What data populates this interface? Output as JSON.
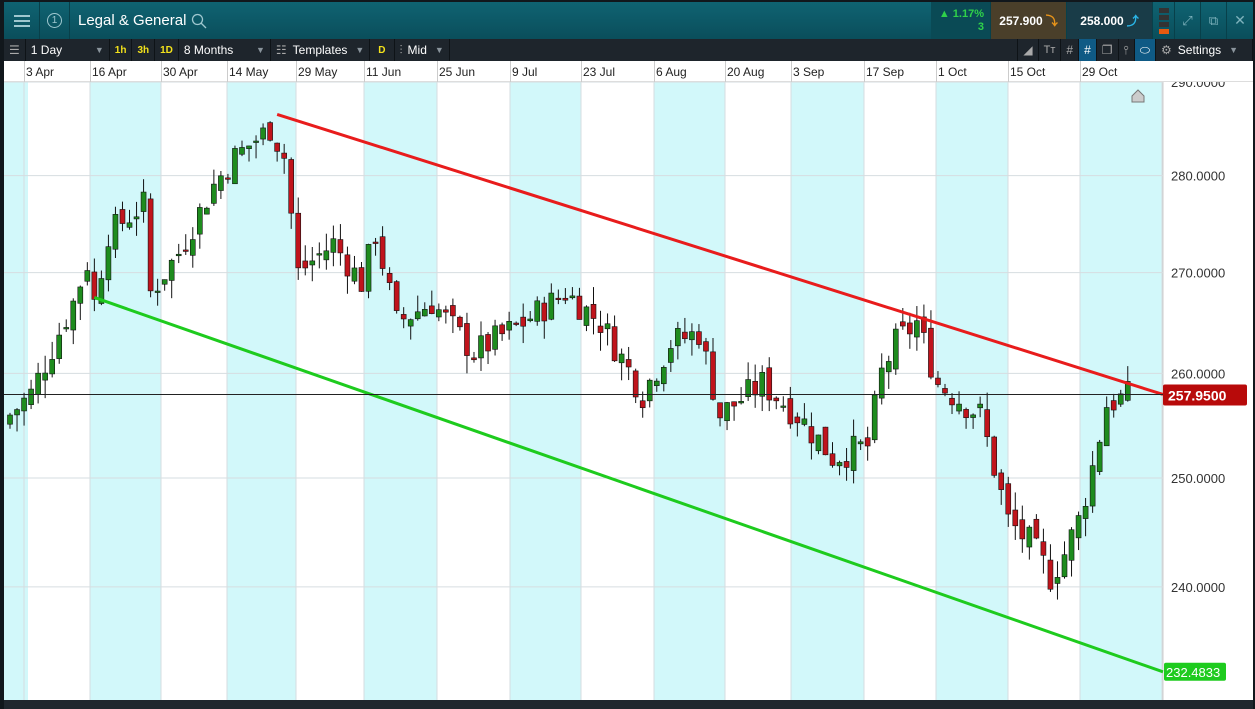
{
  "header": {
    "title": "Legal & General",
    "window_number": "1",
    "change_pct": "▲ 1.17%",
    "change_sub": "3",
    "sell_price": "257.900",
    "buy_price": "258.000"
  },
  "toolbar": {
    "interval": "1 Day",
    "quick": [
      "1h",
      "3h",
      "1D"
    ],
    "range": "8 Months",
    "templates": "Templates",
    "d_button": "D",
    "price_type": "Mid",
    "settings": "Settings"
  },
  "date_axis": [
    "3 Apr",
    "16 Apr",
    "30 Apr",
    "14 May",
    "29 May",
    "11 Jun",
    "25 Jun",
    "9 Jul",
    "23 Jul",
    "6 Aug",
    "20 Aug",
    "3 Sep",
    "17 Sep",
    "1 Oct",
    "15 Oct",
    "29 Oct"
  ],
  "price_axis": [
    "290.0000",
    "280.0000",
    "270.0000",
    "260.0000",
    "250.0000",
    "240.0000"
  ],
  "current_price_label": "257.9500",
  "support_label": "232.4833",
  "colors": {
    "up": "#1e8c1e",
    "down": "#c0141c",
    "resistance": "#e81c1c",
    "support": "#1ecb1e",
    "shade": "#d2f8fa"
  },
  "chart_data": {
    "type": "candlestick",
    "instrument": "Legal & General",
    "scale": "log",
    "ylim": [
      230,
      291
    ],
    "waypoints": [
      [
        0,
        256
      ],
      [
        3,
        258
      ],
      [
        5,
        261
      ],
      [
        9,
        267
      ],
      [
        11,
        271
      ],
      [
        12,
        267
      ],
      [
        14,
        274
      ],
      [
        19,
        277
      ],
      [
        20,
        268
      ],
      [
        24,
        272
      ],
      [
        29,
        279
      ],
      [
        32,
        282
      ],
      [
        37,
        285
      ],
      [
        39,
        282
      ],
      [
        41,
        270
      ],
      [
        46,
        273
      ],
      [
        50,
        269
      ],
      [
        52,
        274
      ],
      [
        55,
        265
      ],
      [
        60,
        267
      ],
      [
        66,
        262
      ],
      [
        73,
        265
      ],
      [
        79,
        268
      ],
      [
        84,
        265
      ],
      [
        90,
        258
      ],
      [
        94,
        263
      ],
      [
        98,
        264
      ],
      [
        101,
        256
      ],
      [
        107,
        259
      ],
      [
        112,
        256
      ],
      [
        117,
        252
      ],
      [
        122,
        253
      ],
      [
        124,
        260
      ],
      [
        126,
        263
      ],
      [
        129,
        265
      ],
      [
        132,
        259
      ],
      [
        138,
        256
      ],
      [
        140,
        251
      ],
      [
        142,
        246
      ],
      [
        145,
        244
      ],
      [
        148,
        241
      ],
      [
        150,
        243
      ],
      [
        152,
        246
      ],
      [
        154,
        251
      ],
      [
        156,
        257
      ],
      [
        159,
        257.8
      ]
    ],
    "resistance_line": {
      "from": [
        38,
        286.5
      ],
      "to": [
        164,
        257.95
      ]
    },
    "support_line": {
      "from": [
        12,
        267.5
      ],
      "to": [
        164,
        232.48
      ]
    }
  }
}
